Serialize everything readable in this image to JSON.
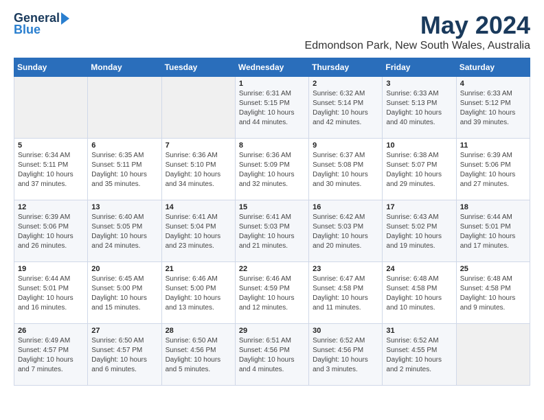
{
  "header": {
    "logo_general": "General",
    "logo_blue": "Blue",
    "title": "May 2024",
    "subtitle": "Edmondson Park, New South Wales, Australia"
  },
  "columns": [
    "Sunday",
    "Monday",
    "Tuesday",
    "Wednesday",
    "Thursday",
    "Friday",
    "Saturday"
  ],
  "weeks": [
    {
      "cells": [
        {
          "day": "",
          "content": ""
        },
        {
          "day": "",
          "content": ""
        },
        {
          "day": "",
          "content": ""
        },
        {
          "day": "1",
          "content": "Sunrise: 6:31 AM\nSunset: 5:15 PM\nDaylight: 10 hours\nand 44 minutes."
        },
        {
          "day": "2",
          "content": "Sunrise: 6:32 AM\nSunset: 5:14 PM\nDaylight: 10 hours\nand 42 minutes."
        },
        {
          "day": "3",
          "content": "Sunrise: 6:33 AM\nSunset: 5:13 PM\nDaylight: 10 hours\nand 40 minutes."
        },
        {
          "day": "4",
          "content": "Sunrise: 6:33 AM\nSunset: 5:12 PM\nDaylight: 10 hours\nand 39 minutes."
        }
      ]
    },
    {
      "cells": [
        {
          "day": "5",
          "content": "Sunrise: 6:34 AM\nSunset: 5:11 PM\nDaylight: 10 hours\nand 37 minutes."
        },
        {
          "day": "6",
          "content": "Sunrise: 6:35 AM\nSunset: 5:11 PM\nDaylight: 10 hours\nand 35 minutes."
        },
        {
          "day": "7",
          "content": "Sunrise: 6:36 AM\nSunset: 5:10 PM\nDaylight: 10 hours\nand 34 minutes."
        },
        {
          "day": "8",
          "content": "Sunrise: 6:36 AM\nSunset: 5:09 PM\nDaylight: 10 hours\nand 32 minutes."
        },
        {
          "day": "9",
          "content": "Sunrise: 6:37 AM\nSunset: 5:08 PM\nDaylight: 10 hours\nand 30 minutes."
        },
        {
          "day": "10",
          "content": "Sunrise: 6:38 AM\nSunset: 5:07 PM\nDaylight: 10 hours\nand 29 minutes."
        },
        {
          "day": "11",
          "content": "Sunrise: 6:39 AM\nSunset: 5:06 PM\nDaylight: 10 hours\nand 27 minutes."
        }
      ]
    },
    {
      "cells": [
        {
          "day": "12",
          "content": "Sunrise: 6:39 AM\nSunset: 5:06 PM\nDaylight: 10 hours\nand 26 minutes."
        },
        {
          "day": "13",
          "content": "Sunrise: 6:40 AM\nSunset: 5:05 PM\nDaylight: 10 hours\nand 24 minutes."
        },
        {
          "day": "14",
          "content": "Sunrise: 6:41 AM\nSunset: 5:04 PM\nDaylight: 10 hours\nand 23 minutes."
        },
        {
          "day": "15",
          "content": "Sunrise: 6:41 AM\nSunset: 5:03 PM\nDaylight: 10 hours\nand 21 minutes."
        },
        {
          "day": "16",
          "content": "Sunrise: 6:42 AM\nSunset: 5:03 PM\nDaylight: 10 hours\nand 20 minutes."
        },
        {
          "day": "17",
          "content": "Sunrise: 6:43 AM\nSunset: 5:02 PM\nDaylight: 10 hours\nand 19 minutes."
        },
        {
          "day": "18",
          "content": "Sunrise: 6:44 AM\nSunset: 5:01 PM\nDaylight: 10 hours\nand 17 minutes."
        }
      ]
    },
    {
      "cells": [
        {
          "day": "19",
          "content": "Sunrise: 6:44 AM\nSunset: 5:01 PM\nDaylight: 10 hours\nand 16 minutes."
        },
        {
          "day": "20",
          "content": "Sunrise: 6:45 AM\nSunset: 5:00 PM\nDaylight: 10 hours\nand 15 minutes."
        },
        {
          "day": "21",
          "content": "Sunrise: 6:46 AM\nSunset: 5:00 PM\nDaylight: 10 hours\nand 13 minutes."
        },
        {
          "day": "22",
          "content": "Sunrise: 6:46 AM\nSunset: 4:59 PM\nDaylight: 10 hours\nand 12 minutes."
        },
        {
          "day": "23",
          "content": "Sunrise: 6:47 AM\nSunset: 4:58 PM\nDaylight: 10 hours\nand 11 minutes."
        },
        {
          "day": "24",
          "content": "Sunrise: 6:48 AM\nSunset: 4:58 PM\nDaylight: 10 hours\nand 10 minutes."
        },
        {
          "day": "25",
          "content": "Sunrise: 6:48 AM\nSunset: 4:58 PM\nDaylight: 10 hours\nand 9 minutes."
        }
      ]
    },
    {
      "cells": [
        {
          "day": "26",
          "content": "Sunrise: 6:49 AM\nSunset: 4:57 PM\nDaylight: 10 hours\nand 7 minutes."
        },
        {
          "day": "27",
          "content": "Sunrise: 6:50 AM\nSunset: 4:57 PM\nDaylight: 10 hours\nand 6 minutes."
        },
        {
          "day": "28",
          "content": "Sunrise: 6:50 AM\nSunset: 4:56 PM\nDaylight: 10 hours\nand 5 minutes."
        },
        {
          "day": "29",
          "content": "Sunrise: 6:51 AM\nSunset: 4:56 PM\nDaylight: 10 hours\nand 4 minutes."
        },
        {
          "day": "30",
          "content": "Sunrise: 6:52 AM\nSunset: 4:56 PM\nDaylight: 10 hours\nand 3 minutes."
        },
        {
          "day": "31",
          "content": "Sunrise: 6:52 AM\nSunset: 4:55 PM\nDaylight: 10 hours\nand 2 minutes."
        },
        {
          "day": "",
          "content": ""
        }
      ]
    }
  ]
}
